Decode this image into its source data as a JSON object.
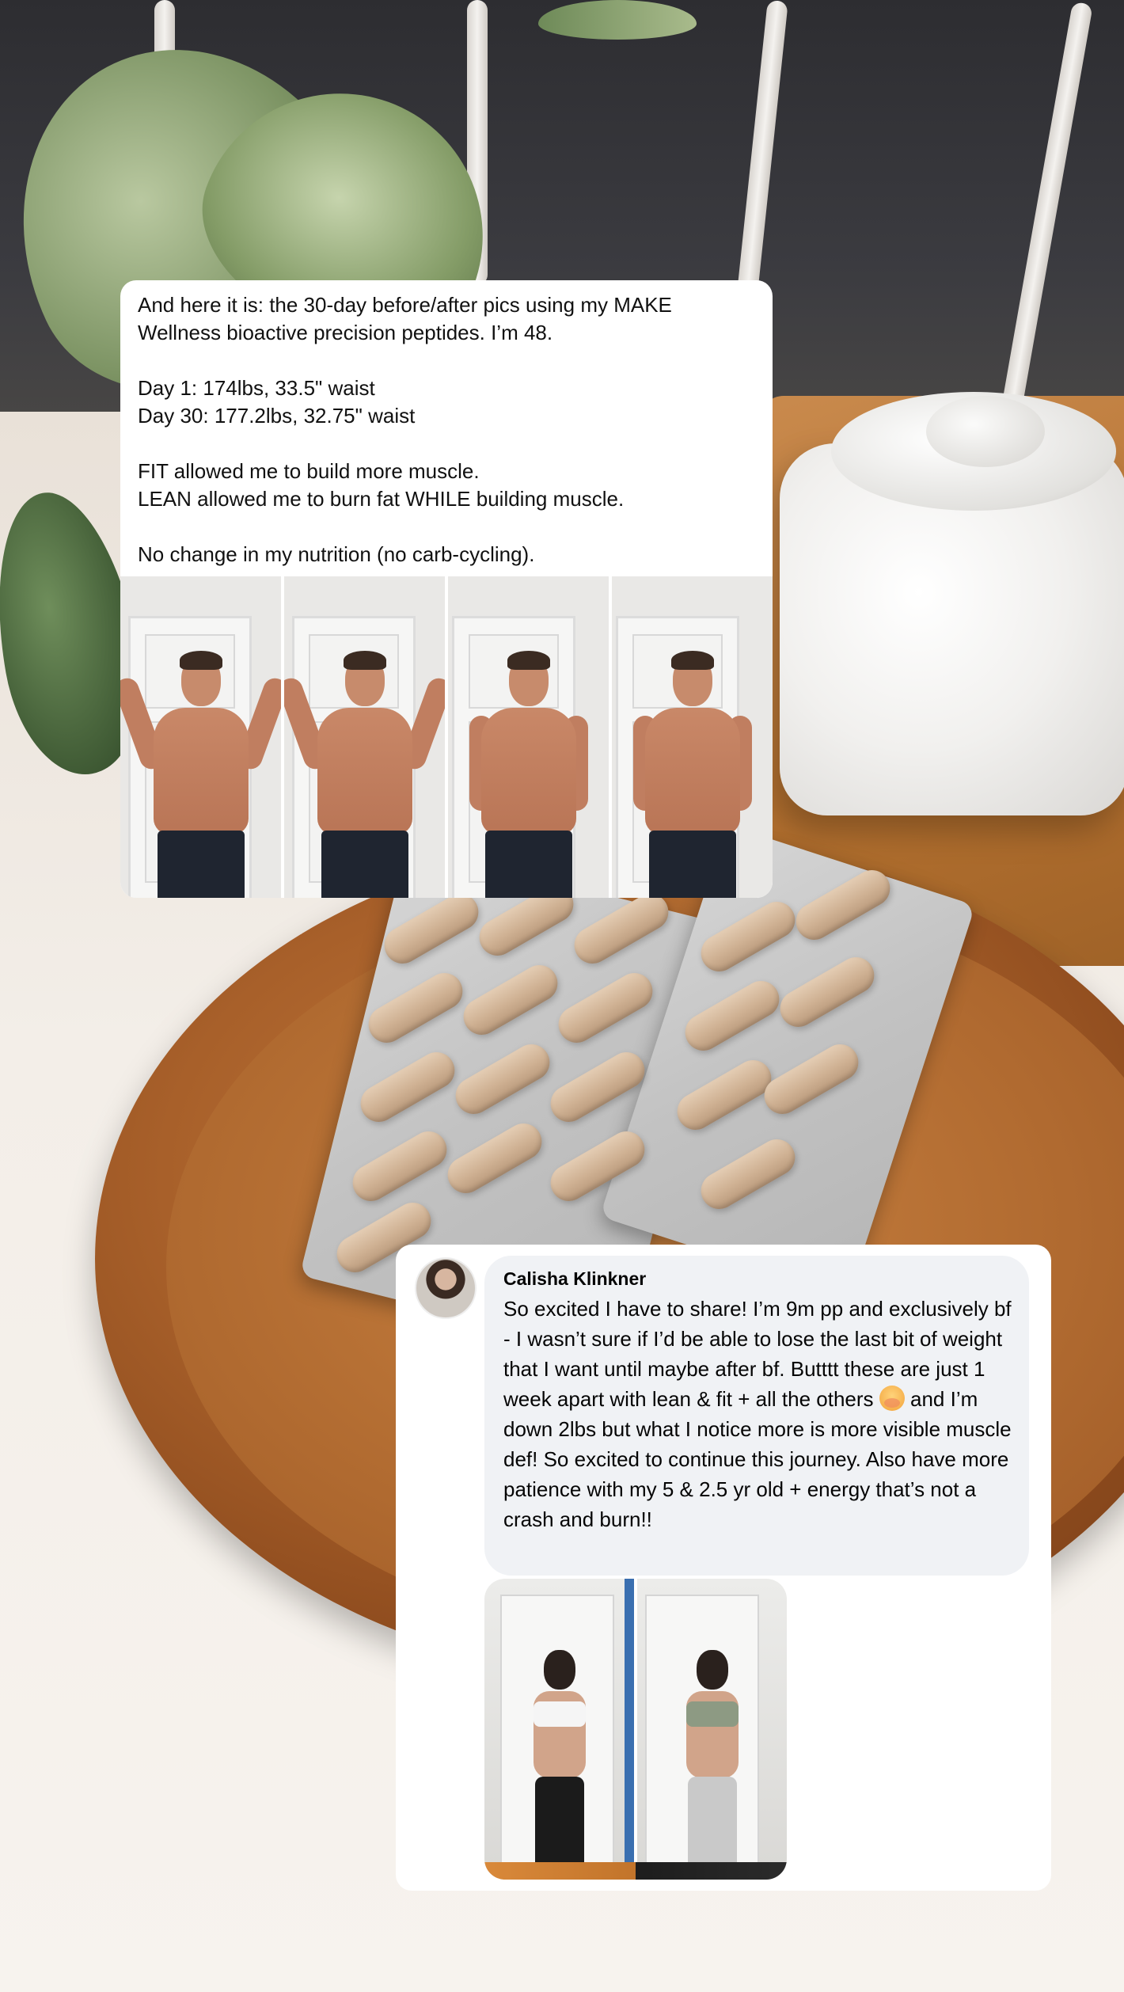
{
  "post": {
    "line1": "And here it is: the 30-day before/after pics using my MAKE",
    "line2": "Wellness bioactive precision peptides. I’m 48.",
    "day1": "Day 1: 174lbs, 33.5\" waist",
    "day30": "Day 30: 177.2lbs, 32.75\" waist",
    "fit": "FIT allowed me to build more muscle.",
    "lean": "LEAN allowed me to burn fat WHILE building muscle.",
    "nutrition": "No change in my nutrition (no carb-cycling)."
  },
  "comment": {
    "author": "Calisha Klinkner",
    "text_before_emoji": "So excited I have to share! I’m 9m pp and exclusively bf - I wasn’t sure if I’d be able to lose the last bit of weight that I want until maybe after bf. Butttt these are just 1 week apart with lean & fit + all the others",
    "text_after_emoji": " and I’m down 2lbs but what I notice more is more visible muscle def! So excited to continue this journey. Also have more patience with my 5 & 2.5 yr old + energy that’s not a crash and burn!!",
    "emoji": "smiling-face-with-hearts"
  },
  "colors": {
    "card_bg": "#ffffff",
    "bubble_bg": "#f0f2f5",
    "text": "#050505"
  }
}
